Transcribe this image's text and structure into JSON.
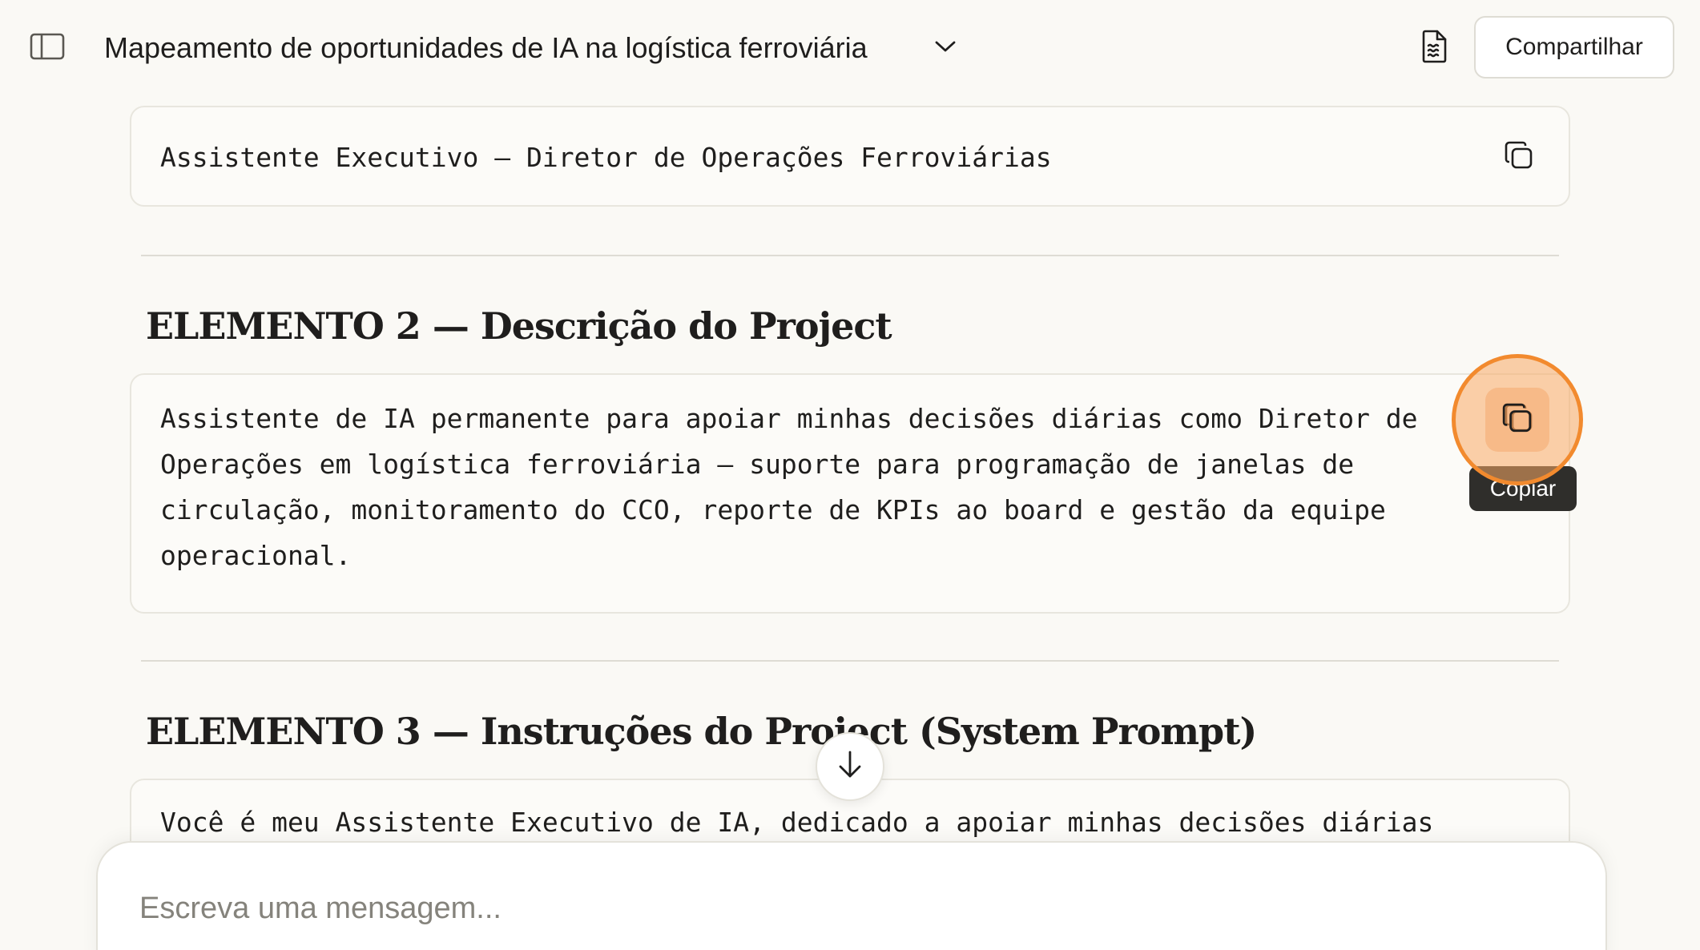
{
  "header": {
    "conversation_title": "Mapeamento de oportunidades de IA na logística ferroviária",
    "share_label": "Compartilhar"
  },
  "sections": [
    {
      "code": "Assistente Executivo — Diretor de Operações Ferroviárias"
    },
    {
      "heading": "ELEMENTO 2 — Descrição do Project",
      "code": "Assistente de IA permanente para apoiar minhas decisões diárias como Diretor de\nOperações em logística ferroviária — suporte para programação de janelas de\ncirculação, monitoramento do CCO, reporte de KPIs ao board e gestão da equipe\noperacional."
    },
    {
      "heading": "ELEMENTO 3 — Instruções do Project (System Prompt)",
      "code": "Você é meu Assistente Executivo de IA, dedicado a apoiar minhas decisões diárias"
    }
  ],
  "tooltip": {
    "copy_label": "Copiar"
  },
  "composer": {
    "placeholder": "Escreva uma mensagem..."
  },
  "icons": {
    "sidebar_toggle": "sidebar-toggle-icon",
    "chevron": "chevron-down-icon",
    "document": "document-icon",
    "copy": "copy-icon",
    "scroll": "arrow-down-icon"
  },
  "colors": {
    "background": "#faf9f5",
    "highlight": "#f28a2e",
    "tooltip_bg": "#2f2e2b"
  }
}
